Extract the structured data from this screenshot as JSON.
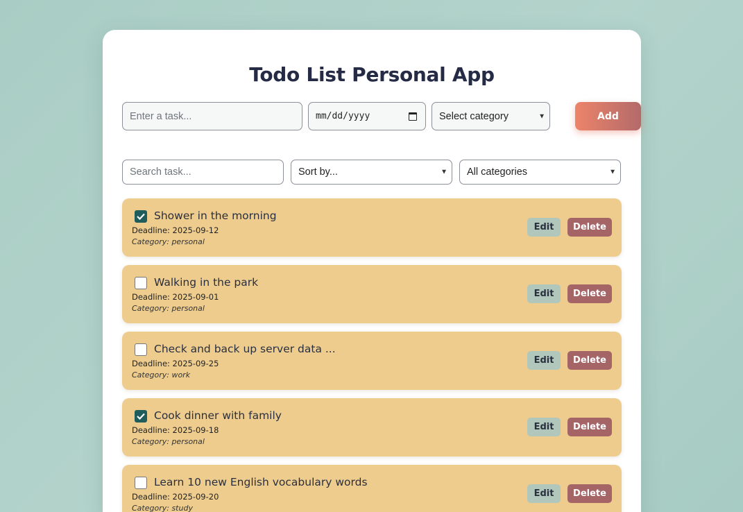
{
  "app": {
    "title": "Todo List Personal App"
  },
  "add_form": {
    "task_placeholder": "Enter a task...",
    "date_placeholder": "mm/dd/yyyy",
    "category_selected": "Select category",
    "add_label": "Add"
  },
  "filters": {
    "search_placeholder": "Search task...",
    "sort_selected": "Sort by...",
    "category_filter_selected": "All categories"
  },
  "tasks": [
    {
      "title": "Shower in the morning",
      "deadline": "Deadline: 2025-09-12",
      "category": "Category: personal",
      "done": true
    },
    {
      "title": "Walking in the park",
      "deadline": "Deadline: 2025-09-01",
      "category": "Category: personal",
      "done": false
    },
    {
      "title": "Check and back up server data ...",
      "deadline": "Deadline: 2025-09-25",
      "category": "Category: work",
      "done": false
    },
    {
      "title": "Cook dinner with family",
      "deadline": "Deadline: 2025-09-18",
      "category": "Category: personal",
      "done": true
    },
    {
      "title": "Learn 10 new English vocabulary words",
      "deadline": "Deadline: 2025-09-20",
      "category": "Category: study",
      "done": false
    }
  ],
  "task_actions": {
    "edit_label": "Edit",
    "delete_label": "Delete"
  },
  "colors": {
    "background": "#a9cdc4",
    "task_card": "#edcc8e",
    "checkbox_checked": "#1f5c5c",
    "delete_button": "#a56566",
    "edit_button": "#b2c7bb",
    "add_button_start": "#ec846a",
    "add_button_end": "#b46a6a"
  }
}
